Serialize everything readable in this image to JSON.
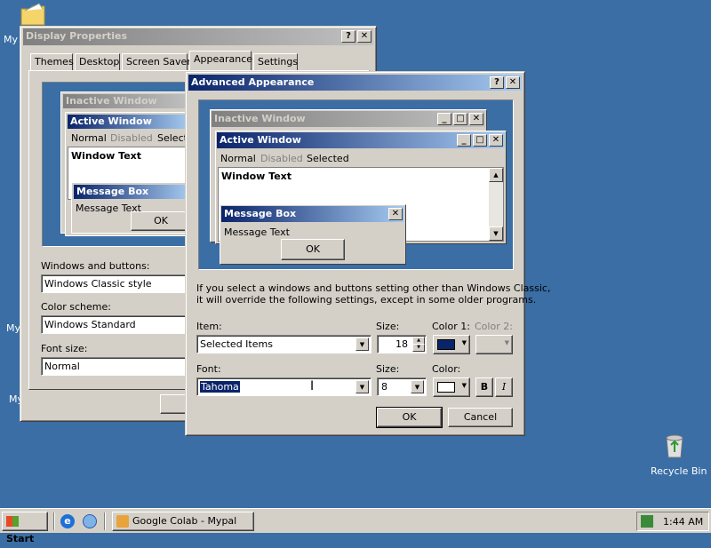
{
  "desktop": {
    "icons": [
      {
        "label": "My"
      },
      {
        "label": "My"
      },
      {
        "label": "My"
      }
    ],
    "recycle_bin": "Recycle Bin"
  },
  "display_properties": {
    "title": "Display Properties",
    "tabs": [
      "Themes",
      "Desktop",
      "Screen Saver",
      "Appearance",
      "Settings"
    ],
    "active_tab": "Appearance",
    "preview": {
      "inactive_title": "Inactive Window",
      "active_title": "Active Window",
      "menu": [
        "Normal",
        "Disabled",
        "Selecte"
      ],
      "window_text": "Window Text",
      "msgbox_title": "Message Box",
      "msgbox_text": "Message Text",
      "ok": "OK"
    },
    "windows_buttons_label": "Windows and buttons:",
    "windows_buttons_value": "Windows Classic style",
    "color_scheme_label": "Color scheme:",
    "color_scheme_value": "Windows Standard",
    "font_size_label": "Font size:",
    "font_size_value": "Normal"
  },
  "advanced": {
    "title": "Advanced Appearance",
    "preview": {
      "inactive_title": "Inactive Window",
      "active_title": "Active Window",
      "menu_normal": "Normal",
      "menu_disabled": "Disabled",
      "menu_selected": "Selected",
      "window_text": "Window Text",
      "msgbox_title": "Message Box",
      "msgbox_text": "Message Text",
      "ok": "OK"
    },
    "info_line1": "If you select a windows and buttons setting other than Windows Classic,",
    "info_line2": "it will override the following settings, except in some older programs.",
    "item_label": "Item:",
    "item_value": "Selected Items",
    "size_label": "Size:",
    "size_value": "18",
    "color1_label": "Color 1:",
    "color2_label": "Color 2:",
    "color1_swatch": "#0a246a",
    "font_label": "Font:",
    "font_value": "Tahoma",
    "font_size_label": "Size:",
    "font_size_value": "8",
    "font_color_label": "Color:",
    "font_color_swatch": "#ffffff",
    "bold_label": "B",
    "italic_label": "I",
    "ok_label": "OK",
    "cancel_label": "Cancel"
  },
  "taskbar": {
    "start": "Start",
    "task": "Google Colab - Mypal",
    "clock": "1:44 AM"
  }
}
